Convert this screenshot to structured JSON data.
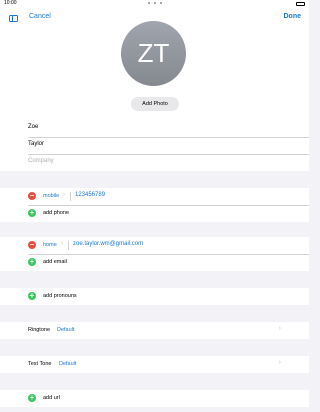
{
  "status": {
    "time": "10:00"
  },
  "nav": {
    "cancel": "Cancel",
    "done": "Done"
  },
  "avatar": {
    "initials": "ZT",
    "add_photo": "Add Photo"
  },
  "name": {
    "first": "Zoe",
    "last": "Taylor",
    "company_placeholder": "Company"
  },
  "phone": {
    "label": "mobile",
    "value": "123456789",
    "add": "add phone"
  },
  "email": {
    "label": "home",
    "value": "zoe.taylor.wm@gmail.com",
    "add": "add email"
  },
  "pronouns": {
    "add": "add pronouns"
  },
  "ringtone": {
    "label": "Ringtone",
    "value": "Default"
  },
  "texttone": {
    "label": "Text Tone",
    "value": "Default"
  },
  "url": {
    "add": "add url"
  },
  "colors": {
    "accent": "#1c78d6",
    "remove": "#eb4d3d",
    "add": "#34c759"
  }
}
